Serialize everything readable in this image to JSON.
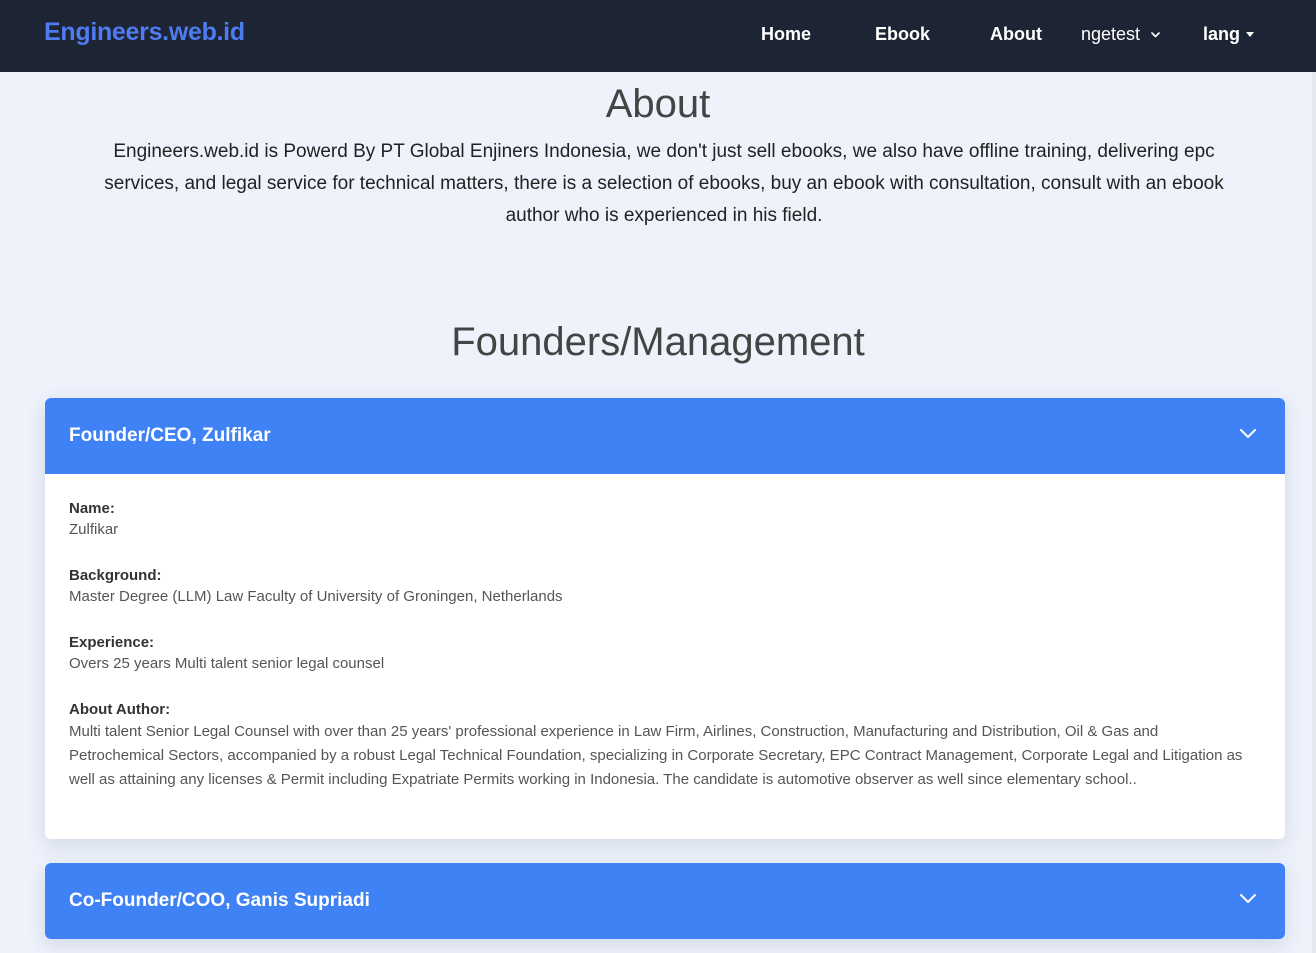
{
  "nav": {
    "brand": "Engineers.web.id",
    "links": {
      "home": "Home",
      "ebook": "Ebook",
      "about": "About",
      "user": "ngetest",
      "lang": "lang"
    }
  },
  "about": {
    "title": "About",
    "description": "Engineers.web.id is Powerd By PT Global Enjiners Indonesia, we don't just sell ebooks, we also have offline training, delivering epc services, and legal service for technical matters, there is a selection of ebooks, buy an ebook with consultation, consult with an ebook author who is experienced in his field."
  },
  "founders": {
    "title": "Founders/Management",
    "cards": [
      {
        "header": "Founder/CEO, Zulfikar",
        "expanded": true,
        "fields": [
          {
            "label": "Name:",
            "value": "Zulfikar"
          },
          {
            "label": "Background:",
            "value": "Master Degree (LLM) Law Faculty of University of Groningen, Netherlands"
          },
          {
            "label": "Experience:",
            "value": "Overs 25 years Multi talent senior legal counsel"
          },
          {
            "label": "About Author:",
            "value": "Multi talent Senior Legal Counsel with over than 25 years' professional experience in Law Firm, Airlines, Construction, Manufacturing and Distribution, Oil & Gas and Petrochemical Sectors, accompanied by a robust Legal Technical Foundation, specializing in Corporate Secretary, EPC Contract Management, Corporate Legal and Litigation as well as attaining any licenses & Permit including Expatriate Permits working in Indonesia. The candidate is automotive observer as well since elementary school.."
          }
        ]
      },
      {
        "header": "Co-Founder/COO, Ganis Supriadi",
        "expanded": false
      }
    ]
  },
  "colors": {
    "navbar_bg": "#1d2434",
    "brand": "#4f7bf0",
    "card_header_bg": "#3f82f6",
    "page_bg": "#eef2fb"
  },
  "icons": {
    "dropdown": "caret-down-icon",
    "accordion": "chevron-down-icon"
  }
}
